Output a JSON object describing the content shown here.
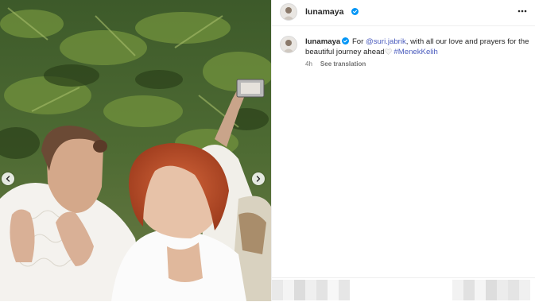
{
  "post": {
    "username": "lunamaya",
    "more_icon": "more-horizontal-icon",
    "verified_icon": "verified-badge-icon"
  },
  "caption": {
    "username": "lunamaya",
    "text_before_mention": "For ",
    "mention": "@suri.jabrik",
    "text_after_mention": ", with all our love and prayers for the beautiful journey ahead",
    "heart_icon": "white-heart-emoji",
    "hashtag": "#MenekKelih",
    "time": "4h",
    "translate_label": "See translation"
  },
  "media": {
    "prev_icon": "chevron-left-icon",
    "next_icon": "chevron-right-icon"
  },
  "colors": {
    "link": "#00376b",
    "hashtag": "#4a5bbd",
    "verified": "#0095f6",
    "meta": "#737373",
    "divider": "#efefef"
  }
}
